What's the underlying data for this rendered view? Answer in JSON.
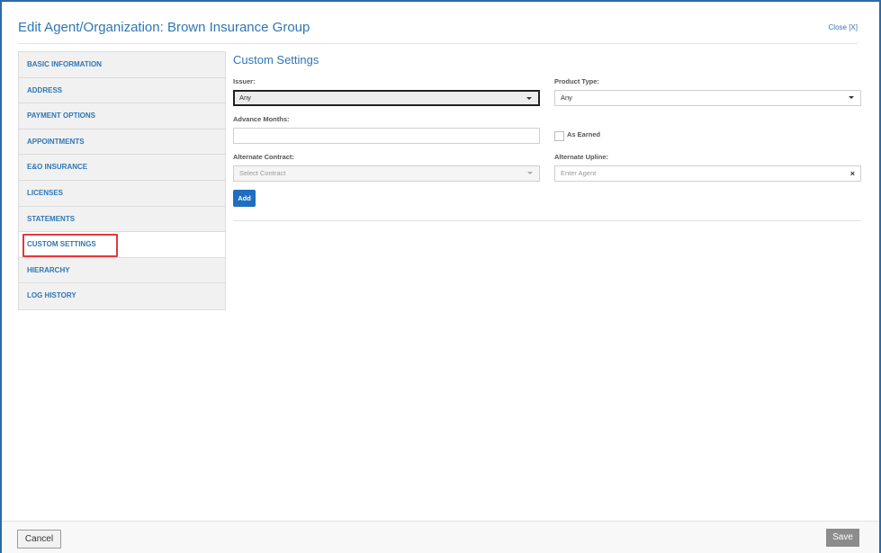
{
  "header": {
    "title": "Edit Agent/Organization: Brown Insurance Group",
    "close_label": "Close [X]"
  },
  "sidebar": {
    "items": [
      {
        "label": "BASIC INFORMATION"
      },
      {
        "label": "ADDRESS"
      },
      {
        "label": "PAYMENT OPTIONS"
      },
      {
        "label": "APPOINTMENTS"
      },
      {
        "label": "E&O INSURANCE"
      },
      {
        "label": "LICENSES"
      },
      {
        "label": "STATEMENTS"
      },
      {
        "label": "CUSTOM SETTINGS"
      },
      {
        "label": "HIERARCHY"
      },
      {
        "label": "LOG HISTORY"
      }
    ],
    "active": "CUSTOM SETTINGS"
  },
  "main": {
    "section_title": "Custom Settings",
    "issuer": {
      "label": "Issuer:",
      "value": "Any"
    },
    "product_type": {
      "label": "Product Type:",
      "value": "Any"
    },
    "advance_months": {
      "label": "Advance Months:",
      "value": ""
    },
    "as_earned": {
      "label": "As Earned",
      "checked": false
    },
    "alternate_contract": {
      "label": "Alternate Contract:",
      "placeholder": "Select Contract"
    },
    "alternate_upline": {
      "label": "Alternate Upline:",
      "placeholder": "Enter Agent",
      "clear_icon": "×"
    },
    "add_label": "Add"
  },
  "footer": {
    "cancel_label": "Cancel",
    "save_label": "Save"
  },
  "colors": {
    "accent": "#2f76b4",
    "border": "#2c6aa8",
    "highlight": "#e0393e",
    "button": "#1f6fbe"
  }
}
